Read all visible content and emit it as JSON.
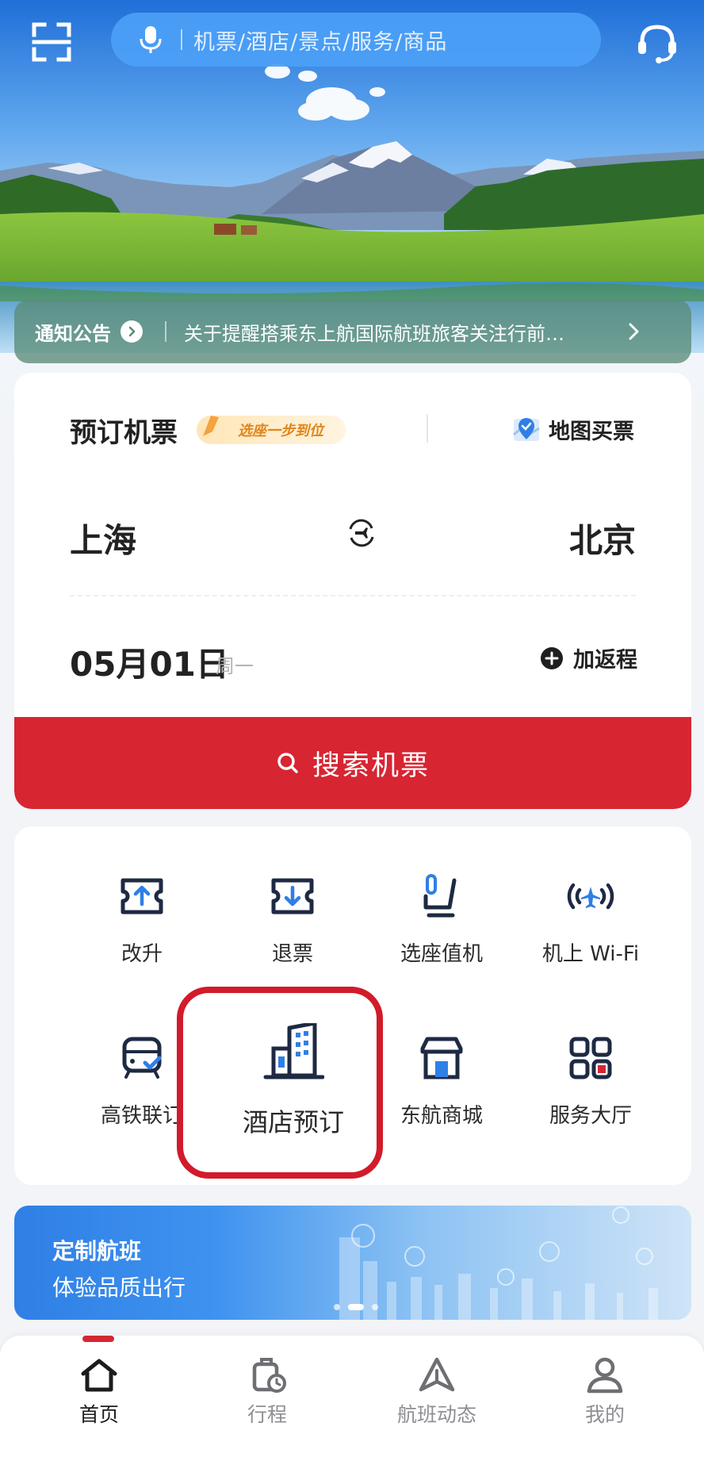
{
  "search": {
    "placeholder": "机票/酒店/景点/服务/商品"
  },
  "notice": {
    "title": "通知公告",
    "text": "关于提醒搭乘东上航国际航班旅客关注行前…"
  },
  "booking": {
    "title": "预订机票",
    "badge": "选座一步到位",
    "map_buy": "地图买票",
    "from_city": "上海",
    "to_city": "北京",
    "date": "05月01日",
    "weekday": "周一",
    "add_return": "加返程",
    "search_button": "搜索机票"
  },
  "services": [
    {
      "label": "改升",
      "icon": "upgrade-ticket-icon"
    },
    {
      "label": "退票",
      "icon": "refund-ticket-icon"
    },
    {
      "label": "选座值机",
      "icon": "seat-checkin-icon"
    },
    {
      "label": "机上 Wi-Fi",
      "icon": "inflight-wifi-icon"
    },
    {
      "label": "高铁联订",
      "icon": "train-icon"
    },
    {
      "label": "酒店预订",
      "icon": "hotel-building-icon"
    },
    {
      "label": "东航商城",
      "icon": "store-icon"
    },
    {
      "label": "服务大厅",
      "icon": "grid-apps-icon"
    }
  ],
  "banner": {
    "title": "定制航班",
    "subtitle": "体验品质出行"
  },
  "tabs": [
    {
      "label": "首页",
      "icon": "home-icon",
      "active": true
    },
    {
      "label": "行程",
      "icon": "luggage-icon",
      "active": false
    },
    {
      "label": "航班动态",
      "icon": "plane-icon",
      "active": false
    },
    {
      "label": "我的",
      "icon": "user-icon",
      "active": false
    }
  ],
  "colors": {
    "brand_red": "#d72532",
    "highlight_red": "#d21b2a",
    "icon_navy": "#1e2a44",
    "icon_blue": "#2f7fe6"
  }
}
